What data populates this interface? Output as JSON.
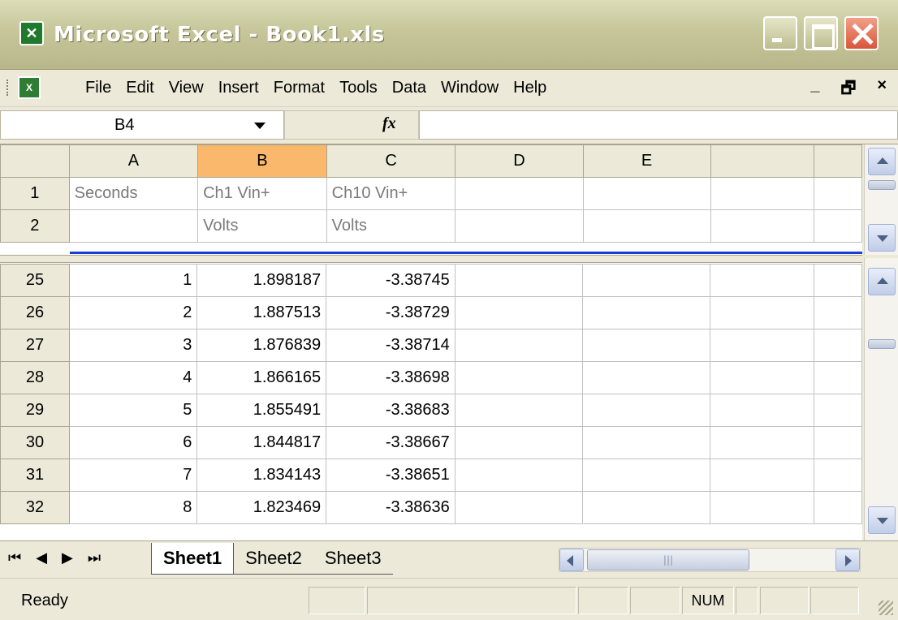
{
  "window": {
    "title": "Microsoft Excel - Book1.xls",
    "app_icon": "excel-icon"
  },
  "menubar": {
    "items": [
      "File",
      "Edit",
      "View",
      "Insert",
      "Format",
      "Tools",
      "Data",
      "Window",
      "Help"
    ],
    "right_controls": [
      "_",
      "🗗",
      "×"
    ]
  },
  "formula_bar": {
    "name_box": "B4",
    "fx_label": "fx",
    "formula_value": ""
  },
  "grid": {
    "columns": [
      "A",
      "B",
      "C",
      "D",
      "E"
    ],
    "selected_column": "B",
    "header_rows": [
      {
        "row": "1",
        "cells": [
          "Seconds",
          "Ch1 Vin+",
          "Ch10 Vin+",
          "",
          ""
        ]
      },
      {
        "row": "2",
        "cells": [
          "",
          "Volts",
          "Volts",
          "",
          ""
        ]
      }
    ],
    "data_rows": [
      {
        "row": "25",
        "cells": [
          "1",
          "1.898187",
          "-3.38745",
          "",
          ""
        ]
      },
      {
        "row": "26",
        "cells": [
          "2",
          "1.887513",
          "-3.38729",
          "",
          ""
        ]
      },
      {
        "row": "27",
        "cells": [
          "3",
          "1.876839",
          "-3.38714",
          "",
          ""
        ]
      },
      {
        "row": "28",
        "cells": [
          "4",
          "1.866165",
          "-3.38698",
          "",
          ""
        ]
      },
      {
        "row": "29",
        "cells": [
          "5",
          "1.855491",
          "-3.38683",
          "",
          ""
        ]
      },
      {
        "row": "30",
        "cells": [
          "6",
          "1.844817",
          "-3.38667",
          "",
          ""
        ]
      },
      {
        "row": "31",
        "cells": [
          "7",
          "1.834143",
          "-3.38651",
          "",
          ""
        ]
      },
      {
        "row": "32",
        "cells": [
          "8",
          "1.823469",
          "-3.38636",
          "",
          ""
        ]
      }
    ]
  },
  "sheet_tabs": {
    "tabs": [
      "Sheet1",
      "Sheet2",
      "Sheet3"
    ],
    "active": "Sheet1"
  },
  "status_bar": {
    "status": "Ready",
    "num_indicator": "NUM"
  },
  "colors": {
    "selected_column_header": "#f9b86b",
    "freeze_line": "#1a3bd6",
    "title_bar": "#c6c69a"
  }
}
